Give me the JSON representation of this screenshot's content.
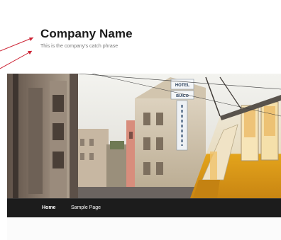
{
  "header": {
    "title": "Company Name",
    "tagline": "This is the company's catch phrase"
  },
  "nav": {
    "items": [
      {
        "label": "Home",
        "active": true
      },
      {
        "label": "Sample Page",
        "active": false
      }
    ]
  },
  "banner": {
    "sign_text": "HOTEL",
    "sign_sub": "BUICO"
  },
  "colors": {
    "nav_bg": "#1c1c1c",
    "annotation_arrow": "#cc2233",
    "tram_yellow": "#e3a41c"
  }
}
